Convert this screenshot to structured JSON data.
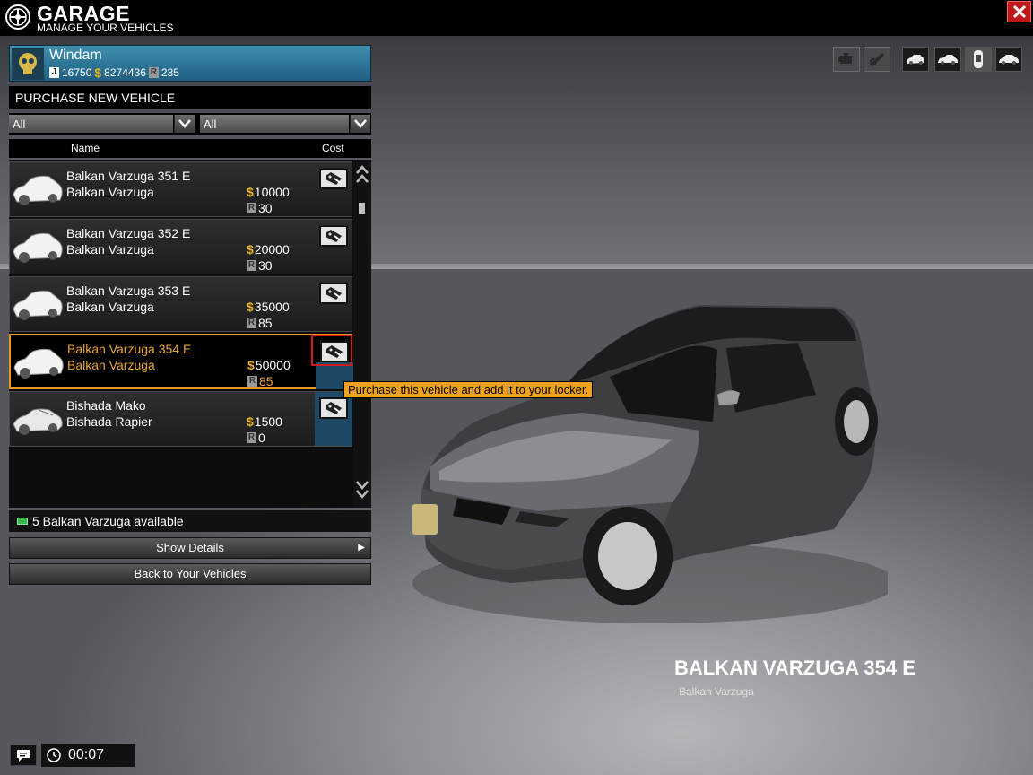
{
  "header": {
    "title": "GARAGE",
    "subtitle": "MANAGE YOUR VEHICLES"
  },
  "profile": {
    "name": "Windam",
    "jobs": "16750",
    "money": "8274436",
    "rep": "235"
  },
  "section": {
    "title": "PURCHASE NEW VEHICLE"
  },
  "filters": [
    {
      "value": "All"
    },
    {
      "value": "All"
    }
  ],
  "columns": {
    "name": "Name",
    "cost": "Cost"
  },
  "vehicles": [
    {
      "name": "Balkan Varzuga 351 E",
      "model": "Balkan Varzuga",
      "price": "10000",
      "rep": "30"
    },
    {
      "name": "Balkan Varzuga 352 E",
      "model": "Balkan Varzuga",
      "price": "20000",
      "rep": "30"
    },
    {
      "name": "Balkan Varzuga 353 E",
      "model": "Balkan Varzuga",
      "price": "35000",
      "rep": "85"
    },
    {
      "name": "Balkan Varzuga 354 E",
      "model": "Balkan Varzuga",
      "price": "50000",
      "rep": "85"
    },
    {
      "name": "Bishada Mako",
      "model": "Bishada Rapier",
      "price": "1500",
      "rep": "0"
    }
  ],
  "tooltip": "Purchase this vehicle and add it to your locker.",
  "status": "5 Balkan Varzuga available",
  "buttons": {
    "details": "Show Details",
    "back": "Back to Your Vehicles"
  },
  "selected_car": {
    "title": "BALKAN VARZUGA 354 E",
    "model": "Balkan Varzuga"
  },
  "timer": "00:07",
  "colors": {
    "accent": "#e8a53a",
    "profile": "#2f7aa0",
    "close": "#c01818",
    "highlight": "#d21b1b"
  }
}
